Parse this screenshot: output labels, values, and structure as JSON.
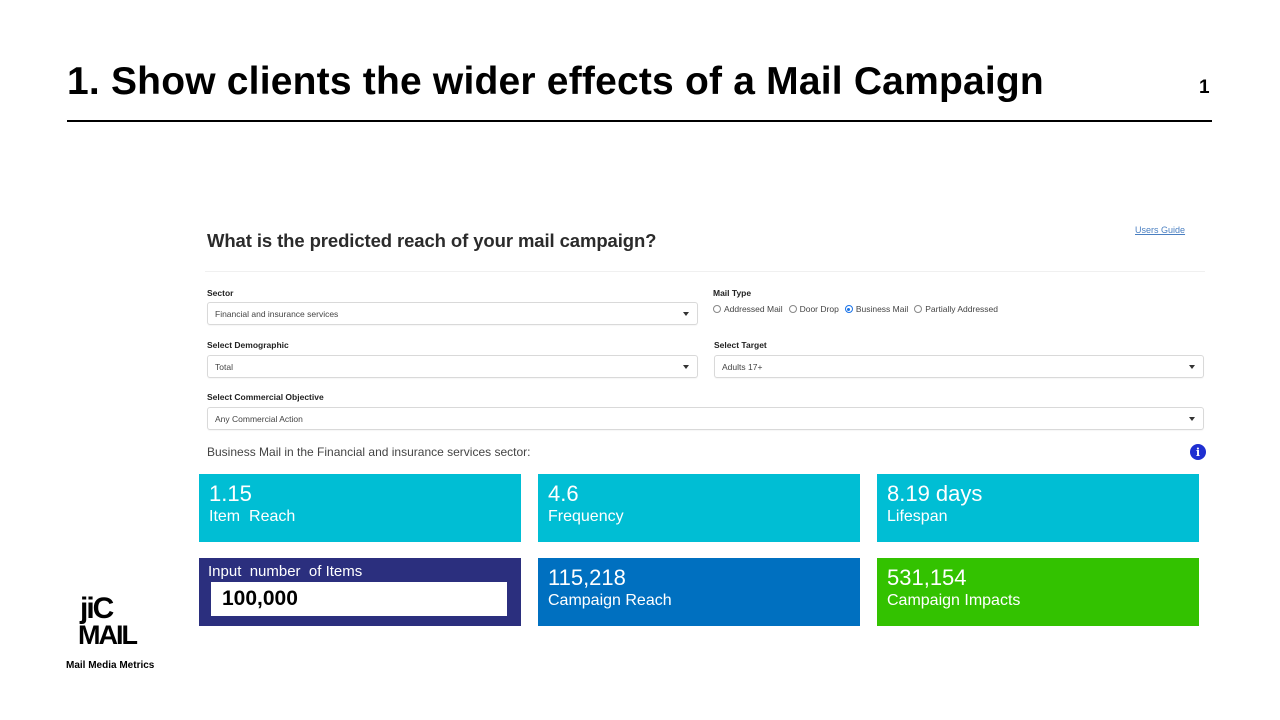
{
  "slide": {
    "title": "1. Show clients the wider effects of a Mail Campaign",
    "page_number": "1"
  },
  "app": {
    "heading": "What is the predicted reach of your mail campaign?",
    "users_guide_link": "Users Guide",
    "sector": {
      "label": "Sector",
      "value": "Financial and insurance services"
    },
    "mail_type": {
      "label": "Mail Type",
      "options": [
        {
          "label": "Addressed Mail",
          "checked": false
        },
        {
          "label": "Door Drop",
          "checked": false
        },
        {
          "label": "Business Mail",
          "checked": true
        },
        {
          "label": "Partially Addressed",
          "checked": false
        }
      ]
    },
    "demographic": {
      "label": "Select Demographic",
      "value": "Total"
    },
    "target": {
      "label": "Select Target",
      "value": "Adults 17+"
    },
    "objective": {
      "label": "Select Commercial Objective",
      "value": "Any Commercial Action"
    },
    "summary": "Business Mail in the Financial and insurance services sector:",
    "info_icon": "info-icon",
    "tiles": {
      "item_reach": {
        "value": "1.15",
        "label": "Item  Reach"
      },
      "frequency": {
        "value": "4.6",
        "label": "Frequency"
      },
      "lifespan": {
        "value": "8.19 days",
        "label": "Lifespan"
      },
      "input_items": {
        "label": "Input  number  of Items",
        "value": "100,000"
      },
      "campaign_reach": {
        "value": "115,218",
        "label": "Campaign Reach"
      },
      "campaign_impacts": {
        "value": "531,154",
        "label": "Campaign Impacts"
      }
    },
    "colors": {
      "cyan_tile": "#00bed4",
      "navy_tile": "#2b2f7e",
      "blue_tile": "#0070c0",
      "green_tile": "#33c200",
      "radio_selected": "#1a73e8",
      "info_icon": "#1f2fd1"
    }
  },
  "logo": {
    "line1": "jiC",
    "line2": "MAIL",
    "tagline": "Mail Media Metrics"
  }
}
